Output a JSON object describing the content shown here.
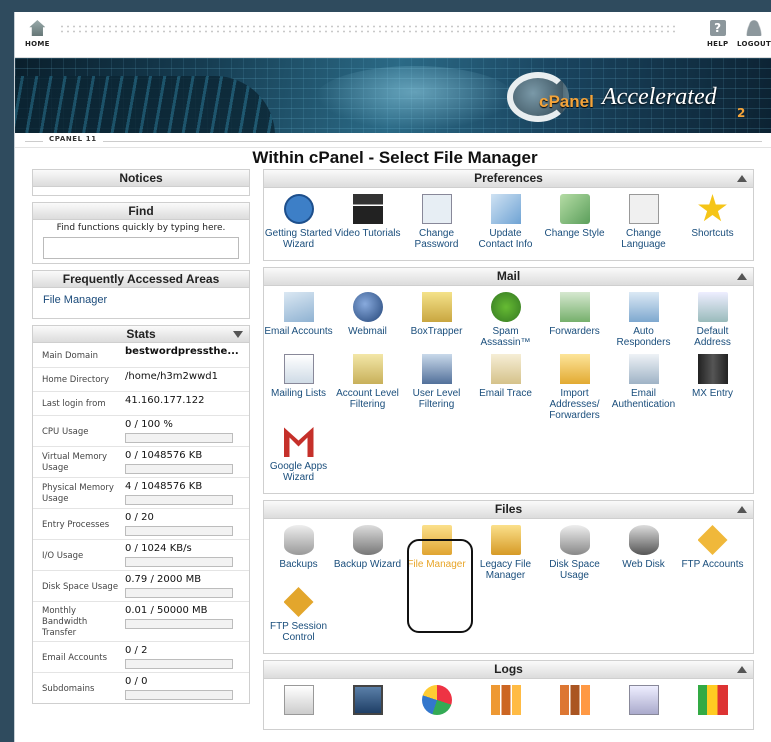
{
  "topbar": {
    "home_label": "HOME",
    "help_label": "HELP",
    "logout_label": "LOGOUT"
  },
  "banner": {
    "cpanel_text": "cPanel",
    "accelerated_text": "Accelerated",
    "version_sup": "2"
  },
  "version_label": "CPANEL 11",
  "page_heading": "Within cPanel - Select File Manager",
  "notices": {
    "title": "Notices"
  },
  "find": {
    "title": "Find",
    "hint": "Find functions quickly by typing here.",
    "value": ""
  },
  "faa": {
    "title": "Frequently Accessed Areas",
    "link": "File Manager"
  },
  "stats": {
    "title": "Stats",
    "rows": [
      {
        "label": "Main Domain",
        "value": "bestwordpressthe...",
        "bold": true
      },
      {
        "label": "Home Directory",
        "value": "/home/h3m2wwd1"
      },
      {
        "label": "Last login from",
        "value": "41.160.177.122"
      },
      {
        "label": "CPU Usage",
        "value": "0 / 100 %",
        "progress": 0
      },
      {
        "label": "Virtual Memory Usage",
        "value": "0 / 1048576 KB",
        "progress": 0
      },
      {
        "label": "Physical Memory Usage",
        "value": "4 / 1048576 KB",
        "progress": 0
      },
      {
        "label": "Entry Processes",
        "value": "0 / 20",
        "progress": 0
      },
      {
        "label": "I/O Usage",
        "value": "0 / 1024 KB/s",
        "progress": 0
      },
      {
        "label": "Disk Space Usage",
        "value": "0.79 / 2000 MB",
        "progress": 0
      },
      {
        "label": "Monthly Bandwidth Transfer",
        "value": "0.01 / 50000 MB",
        "progress": 0
      },
      {
        "label": "Email Accounts",
        "value": "0 / 2",
        "progress": 0
      },
      {
        "label": "Subdomains",
        "value": "0 / 0",
        "progress": 0
      }
    ]
  },
  "sections": [
    {
      "title": "Preferences",
      "items": [
        {
          "label": "Getting Started Wizard",
          "icon": "play-icon"
        },
        {
          "label": "Video Tutorials",
          "icon": "clapperboard-icon"
        },
        {
          "label": "Change Password",
          "icon": "password-icon"
        },
        {
          "label": "Update Contact Info",
          "icon": "contact-icon"
        },
        {
          "label": "Change Style",
          "icon": "style-icon"
        },
        {
          "label": "Change Language",
          "icon": "language-icon"
        },
        {
          "label": "Shortcuts",
          "icon": "star-icon"
        }
      ]
    },
    {
      "title": "Mail",
      "items": [
        {
          "label": "Email Accounts",
          "icon": "envelope-icon"
        },
        {
          "label": "Webmail",
          "icon": "globe-mail-icon"
        },
        {
          "label": "BoxTrapper",
          "icon": "boxtrapper-icon"
        },
        {
          "label": "Spam Assassin™",
          "icon": "spamassassin-icon"
        },
        {
          "label": "Forwarders",
          "icon": "forward-mail-icon"
        },
        {
          "label": "Auto Responders",
          "icon": "autoresponder-icon"
        },
        {
          "label": "Default Address",
          "icon": "default-address-icon"
        },
        {
          "label": "Mailing Lists",
          "icon": "mailing-list-icon"
        },
        {
          "label": "Account Level Filtering",
          "icon": "account-filter-icon"
        },
        {
          "label": "User Level Filtering",
          "icon": "user-filter-icon"
        },
        {
          "label": "Email Trace",
          "icon": "trace-icon"
        },
        {
          "label": "Import Addresses/ Forwarders",
          "icon": "import-icon"
        },
        {
          "label": "Email Authentication",
          "icon": "authentication-icon"
        },
        {
          "label": "MX Entry",
          "icon": "server-icon"
        },
        {
          "label": "Google Apps Wizard",
          "icon": "gmail-icon"
        }
      ]
    },
    {
      "title": "Files",
      "items": [
        {
          "label": "Backups",
          "icon": "disk-icon"
        },
        {
          "label": "Backup Wizard",
          "icon": "backup-wizard-icon"
        },
        {
          "label": "File Manager",
          "icon": "folder-icon",
          "highlight": true
        },
        {
          "label": "Legacy File Manager",
          "icon": "legacy-folder-icon"
        },
        {
          "label": "Disk Space Usage",
          "icon": "disk-usage-icon"
        },
        {
          "label": "Web Disk",
          "icon": "web-disk-icon"
        },
        {
          "label": "FTP Accounts",
          "icon": "ftp-icon"
        },
        {
          "label": "FTP Session Control",
          "icon": "ftp-session-icon"
        }
      ]
    },
    {
      "title": "Logs",
      "items": [
        {
          "label": "",
          "icon": "log-list-icon"
        },
        {
          "label": "",
          "icon": "monitor-icon"
        },
        {
          "label": "",
          "icon": "pie-chart-icon"
        },
        {
          "label": "",
          "icon": "bar-chart-icon"
        },
        {
          "label": "",
          "icon": "bar-chart-2-icon"
        },
        {
          "label": "",
          "icon": "log-page-icon"
        },
        {
          "label": "",
          "icon": "stats-chart-icon"
        }
      ]
    }
  ]
}
